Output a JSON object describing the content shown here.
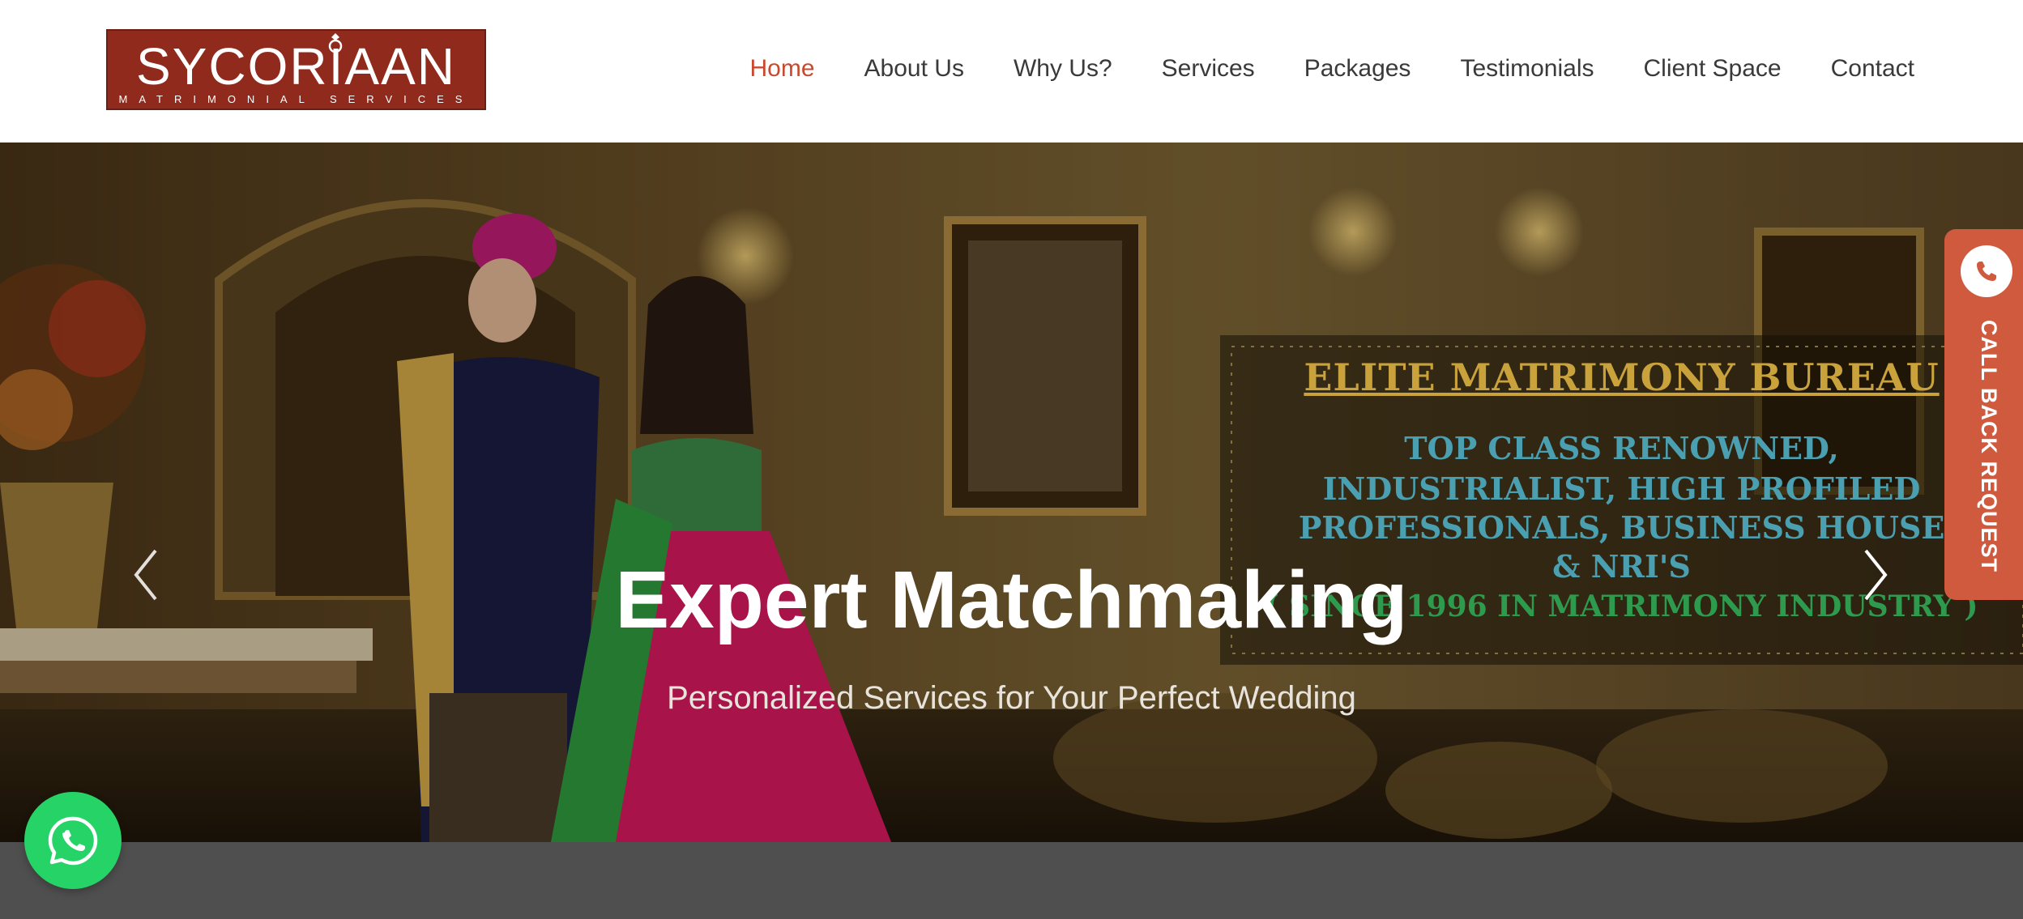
{
  "logo": {
    "main": "SYCORIAAN",
    "sub": "MATRIMONIAL SERVICES"
  },
  "nav": {
    "items": [
      "Home",
      "About Us",
      "Why Us?",
      "Services",
      "Packages",
      "Testimonials",
      "Client Space",
      "Contact"
    ],
    "active": "Home"
  },
  "hero": {
    "title": "Expert Matchmaking",
    "subtitle": "Personalized Services for Your Perfect Wedding",
    "promo": {
      "heading": "ELITE MATRIMONY BUREAU",
      "lines": [
        "TOP CLASS RENOWNED,",
        "INDUSTRIALIST, HIGH PROFILED",
        "PROFESSIONALS, BUSINESS HOUSE",
        "& NRI'S"
      ],
      "since": "( SINCE 1996 IN MATRIMONY INDUSTRY )"
    }
  },
  "callback": {
    "label": "CALL BACK REQUEST"
  },
  "colors": {
    "brand": "#8f2a1c",
    "active_nav": "#c9492e",
    "callback_tab": "#cf5a3e",
    "whatsapp": "#25d366",
    "bottom_band": "#4f4f4f"
  },
  "icons": {
    "prev": "chevron-left-icon",
    "next": "chevron-right-icon",
    "whatsapp": "whatsapp-icon",
    "phone": "phone-icon"
  }
}
